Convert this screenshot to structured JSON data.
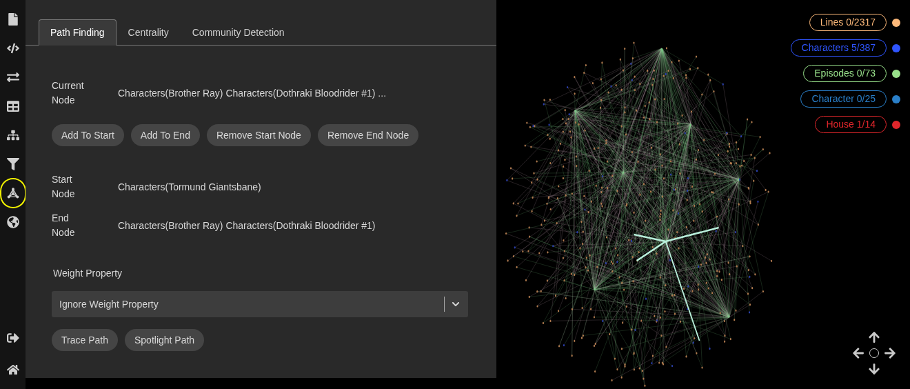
{
  "sidebar": {
    "top_items": [
      {
        "kind": "file",
        "selected": false
      },
      {
        "kind": "code",
        "selected": false
      },
      {
        "kind": "swap",
        "selected": false
      },
      {
        "kind": "table",
        "selected": false
      },
      {
        "kind": "hierarchy",
        "selected": false
      },
      {
        "kind": "filter",
        "selected": false
      },
      {
        "kind": "network",
        "selected": true
      },
      {
        "kind": "globe",
        "selected": false
      }
    ],
    "bottom_items": [
      {
        "kind": "logout",
        "selected": false
      },
      {
        "kind": "home",
        "selected": false
      }
    ]
  },
  "tabs": [
    {
      "label": "Path Finding",
      "selected": true
    },
    {
      "label": "Centrality",
      "selected": false
    },
    {
      "label": "Community Detection",
      "selected": false
    }
  ],
  "current_node": {
    "label": "Current Node",
    "value": "Characters(Brother Ray) Characters(Dothraki Bloodrider #1) ..."
  },
  "node_buttons": [
    "Add To Start",
    "Add To End",
    "Remove Start Node",
    "Remove End Node"
  ],
  "start_node": {
    "label": "Start Node",
    "value": "Characters(Tormund Giantsbane)"
  },
  "end_node": {
    "label": "End Node",
    "value": "Characters(Brother Ray) Characters(Dothraki Bloodrider #1)"
  },
  "weight_property": {
    "label": "Weight Property",
    "value": "Ignore Weight Property"
  },
  "path_buttons": [
    "Trace Path",
    "Spotlight Path"
  ],
  "legend": [
    {
      "label": "Lines 0/2317",
      "color": "#fdb97a"
    },
    {
      "label": "Characters 5/387",
      "color": "#2f55ff"
    },
    {
      "label": "Episodes 0/73",
      "color": "#98e08a"
    },
    {
      "label": "Character 0/25",
      "color": "#2a7fc9"
    },
    {
      "label": "House 1/14",
      "color": "#e0262b"
    }
  ]
}
